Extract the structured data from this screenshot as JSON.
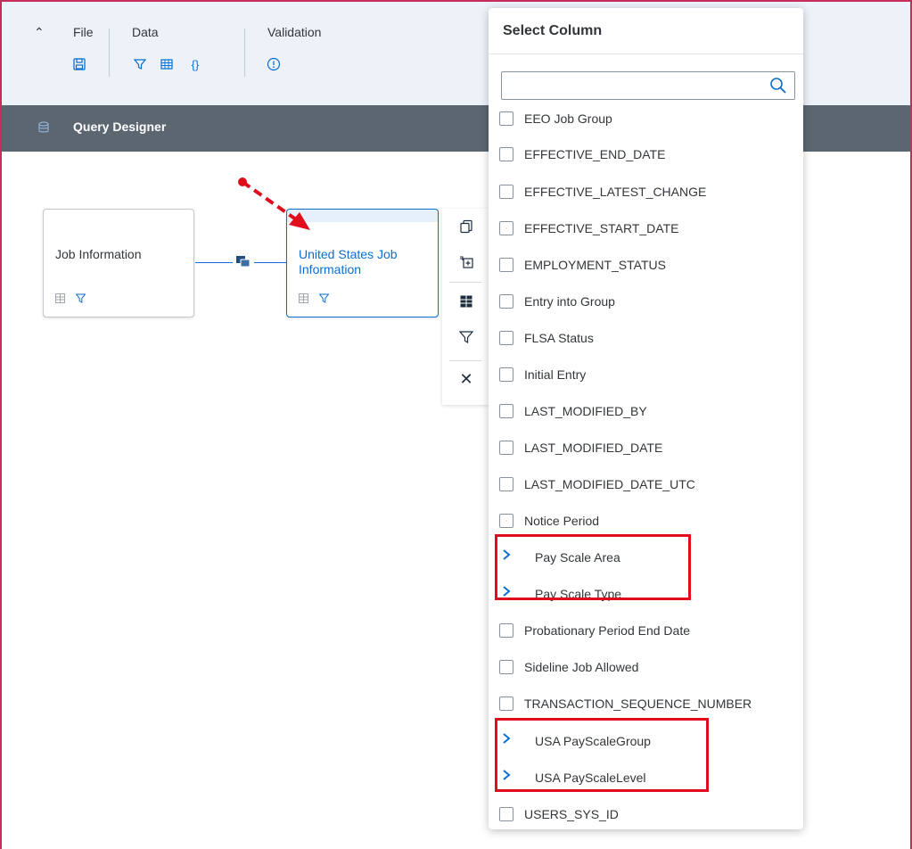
{
  "ribbon": {
    "groups": [
      {
        "label": "File"
      },
      {
        "label": "Data"
      },
      {
        "label": "Validation"
      }
    ]
  },
  "designer": {
    "title": "Query Designer"
  },
  "canvas": {
    "nodes": [
      {
        "title": "Job Information",
        "selected": false
      },
      {
        "title": "United States Job Information",
        "selected": true
      }
    ]
  },
  "select_column": {
    "title": "Select Column",
    "search_value": "",
    "items": [
      {
        "label": "EEO Job Group",
        "kind": "checkbox"
      },
      {
        "label": "EFFECTIVE_END_DATE",
        "kind": "checkbox"
      },
      {
        "label": "EFFECTIVE_LATEST_CHANGE",
        "kind": "checkbox"
      },
      {
        "label": "EFFECTIVE_START_DATE",
        "kind": "checkbox"
      },
      {
        "label": "EMPLOYMENT_STATUS",
        "kind": "checkbox"
      },
      {
        "label": "Entry into Group",
        "kind": "checkbox"
      },
      {
        "label": "FLSA Status",
        "kind": "checkbox"
      },
      {
        "label": "Initial Entry",
        "kind": "checkbox"
      },
      {
        "label": "LAST_MODIFIED_BY",
        "kind": "checkbox"
      },
      {
        "label": "LAST_MODIFIED_DATE",
        "kind": "checkbox"
      },
      {
        "label": "LAST_MODIFIED_DATE_UTC",
        "kind": "checkbox"
      },
      {
        "label": "Notice Period",
        "kind": "checkbox"
      },
      {
        "label": "Pay Scale Area",
        "kind": "expandable"
      },
      {
        "label": "Pay Scale Type",
        "kind": "expandable"
      },
      {
        "label": "Probationary Period End Date",
        "kind": "checkbox"
      },
      {
        "label": "Sideline Job Allowed",
        "kind": "checkbox"
      },
      {
        "label": "TRANSACTION_SEQUENCE_NUMBER",
        "kind": "checkbox"
      },
      {
        "label": "USA PayScaleGroup",
        "kind": "expandable"
      },
      {
        "label": "USA PayScaleLevel",
        "kind": "expandable"
      },
      {
        "label": "USERS_SYS_ID",
        "kind": "checkbox"
      }
    ]
  },
  "colors": {
    "accent": "#0a6ed1",
    "highlight": "#e10d1c",
    "shell_bar": "#5b6670",
    "ribbon_bg": "#edf2f9"
  }
}
